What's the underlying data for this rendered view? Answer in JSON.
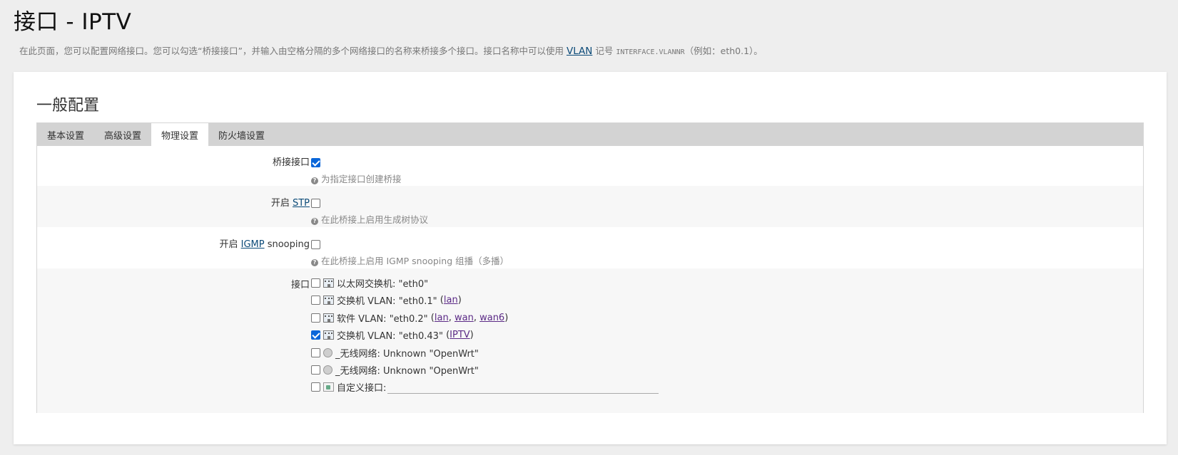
{
  "page": {
    "title": "接口 - IPTV",
    "desc_before": "在此页面，您可以配置网络接口。您可以勾选“桥接接口”，并输入由空格分隔的多个网络接口的名称来桥接多个接口。接口名称中可以使用",
    "desc_link": "VLAN",
    "desc_middle": " 记号 ",
    "desc_code": "INTERFACE.VLANNR",
    "desc_after": "（例如：eth0.1）。"
  },
  "section": {
    "title": "一般配置"
  },
  "tabs": [
    {
      "label": "基本设置",
      "active": false
    },
    {
      "label": "高级设置",
      "active": false
    },
    {
      "label": "物理设置",
      "active": true
    },
    {
      "label": "防火墙设置",
      "active": false
    }
  ],
  "fields": {
    "bridge": {
      "label": "桥接接口",
      "checked": true,
      "help": "为指定接口创建桥接"
    },
    "stp": {
      "label_prefix": "开启 ",
      "label_link": "STP",
      "checked": false,
      "help": "在此桥接上启用生成树协议"
    },
    "igmp": {
      "label_prefix": "开启 ",
      "label_link": "IGMP",
      "label_suffix": " snooping",
      "checked": false,
      "help": "在此桥接上启用 IGMP snooping 组播（多播）"
    },
    "interfaces": {
      "label": "接口",
      "items": [
        {
          "icon": "ethernet-switch-icon",
          "text": "以太网交换机: \"eth0\"",
          "checked": false,
          "links": []
        },
        {
          "icon": "ethernet-switch-icon",
          "text": "交换机 VLAN: \"eth0.1\"",
          "checked": false,
          "links": [
            "lan"
          ]
        },
        {
          "icon": "ethernet-switch-icon",
          "text": "软件 VLAN: \"eth0.2\"",
          "checked": false,
          "links": [
            "lan",
            "wan",
            "wan6"
          ]
        },
        {
          "icon": "ethernet-switch-icon",
          "text": "交换机 VLAN: \"eth0.43\"",
          "checked": true,
          "links": [
            "IPTV"
          ]
        },
        {
          "icon": "wifi-icon",
          "text": "_无线网络: Unknown \"OpenWrt\"",
          "checked": false,
          "links": []
        },
        {
          "icon": "wifi-icon",
          "text": "_无线网络: Unknown \"OpenWrt\"",
          "checked": false,
          "links": []
        }
      ],
      "custom": {
        "label": "自定义接口:",
        "value": ""
      }
    }
  },
  "colors": {
    "background": "#eeeeee",
    "tab_bar": "#d3d3d3",
    "link": "#0b4a78",
    "checkbox_checked": "#0a66d9"
  }
}
